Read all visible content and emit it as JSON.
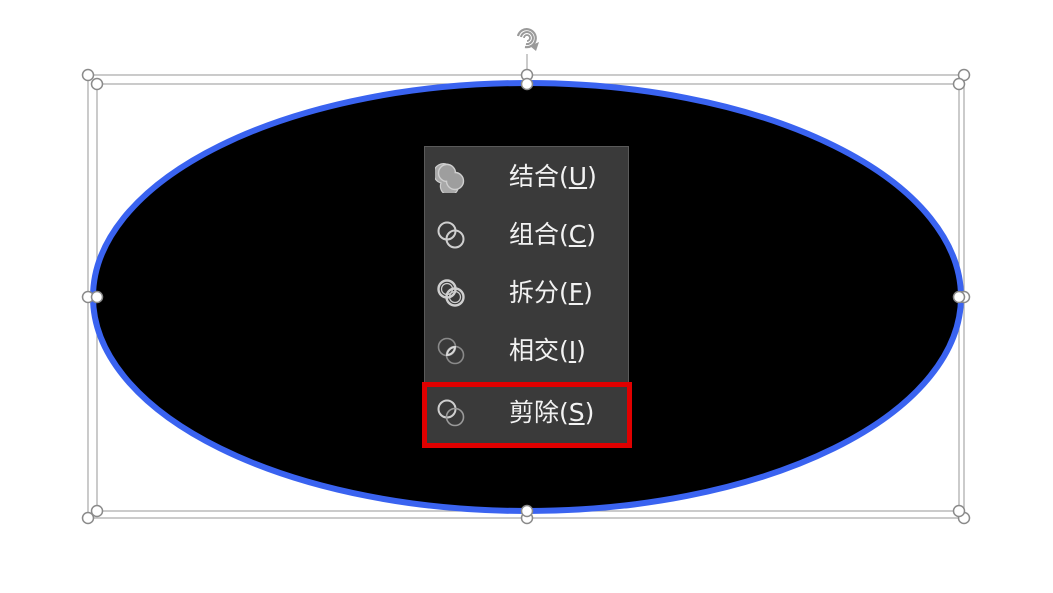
{
  "canvas": {
    "shape_fill": "#000000",
    "shape_outline": "#3a63f0",
    "selection_color": "#a0a0a0",
    "highlight_color": "#e00000"
  },
  "menu": {
    "background": "#3a3a3a",
    "text_color": "#f2f2f2",
    "items": [
      {
        "label": "结合(",
        "key": "U",
        "close": ")",
        "icon": "union-shapes-icon"
      },
      {
        "label": "组合(",
        "key": "C",
        "close": ")",
        "icon": "combine-shapes-icon"
      },
      {
        "label": "拆分(",
        "key": "F",
        "close": ")",
        "icon": "fragment-shapes-icon"
      },
      {
        "label": "相交(",
        "key": "I",
        "close": ")",
        "icon": "intersect-shapes-icon"
      },
      {
        "label": "剪除(",
        "key": "S",
        "close": ")",
        "icon": "subtract-shapes-icon"
      }
    ],
    "highlighted_item": "剪除(S)"
  }
}
